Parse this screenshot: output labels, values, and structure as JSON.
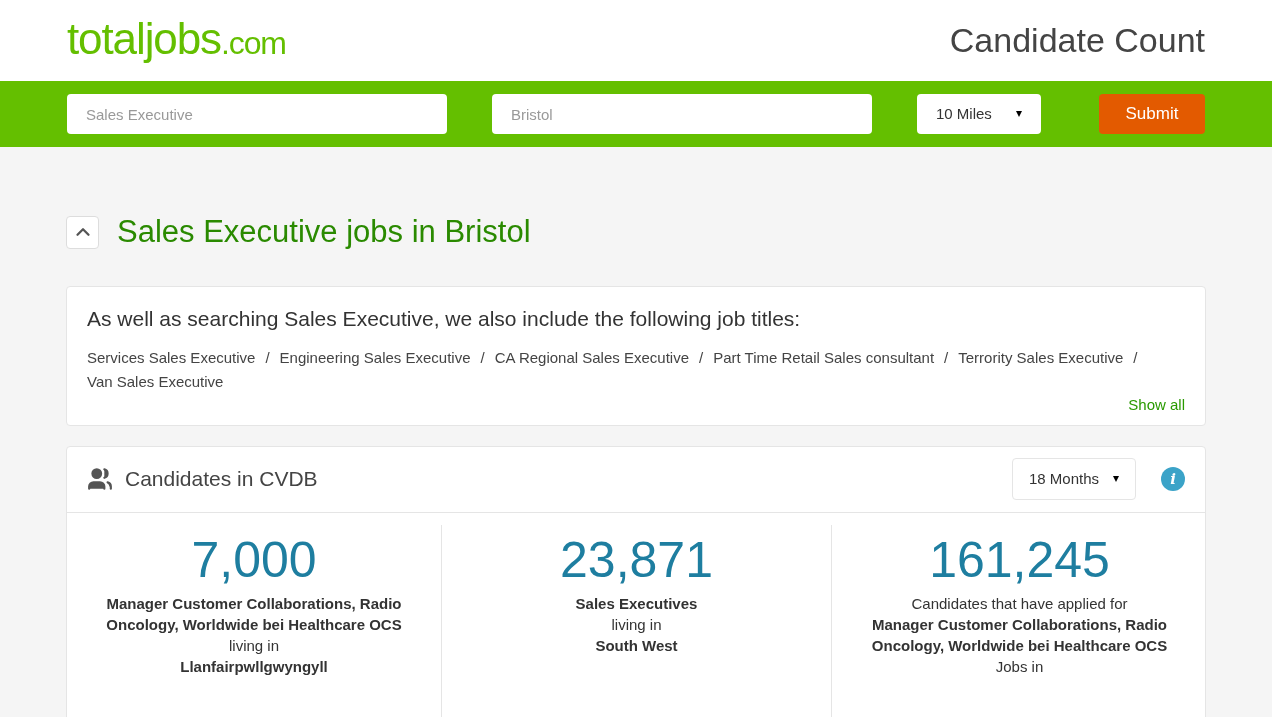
{
  "header": {
    "logo": "totaljobs",
    "logo_suffix": ".com",
    "title": "Candidate Count"
  },
  "search": {
    "job_placeholder": "Sales Executive",
    "location_placeholder": "Bristol",
    "radius": "10 Miles",
    "submit": "Submit"
  },
  "results": {
    "expanded": true,
    "heading": "Sales Executive jobs in Bristol"
  },
  "related": {
    "intro": "As well as searching Sales Executive, we also include the following job titles:",
    "titles": [
      "Services Sales Executive",
      "Engineering Sales Executive",
      "CA Regional Sales Executive",
      "Part Time Retail Sales consultant",
      "Terrority Sales Executive",
      "Van Sales Executive"
    ],
    "separator": "/",
    "show_all": "Show all"
  },
  "cvdb": {
    "title": "Candidates in CVDB",
    "period": "18 Months",
    "info": "i",
    "stats": [
      {
        "value": "7,000",
        "lines": [
          {
            "text": "Manager Customer Collaborations, Radio Oncology, Worldwide bei Healthcare OCS",
            "bold": true
          },
          {
            "text": "living in",
            "bold": false
          },
          {
            "text": "Llanfairpwllgwyngyll",
            "bold": true
          }
        ]
      },
      {
        "value": "23,871",
        "lines": [
          {
            "text": "Sales Executives",
            "bold": true
          },
          {
            "text": "living in",
            "bold": false
          },
          {
            "text": "South West",
            "bold": true
          }
        ]
      },
      {
        "value": "161,245",
        "lines": [
          {
            "text": "Candidates that have applied for",
            "bold": false
          },
          {
            "text": "Manager Customer Collaborations, Radio Oncology, Worldwide bei Healthcare OCS",
            "bold": true
          },
          {
            "text": "Jobs in",
            "bold": false
          }
        ]
      }
    ]
  }
}
